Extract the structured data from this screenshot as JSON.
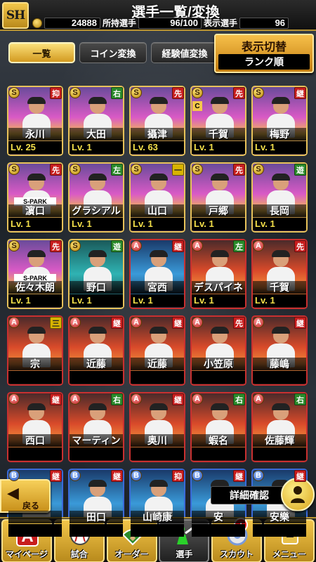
{
  "header": {
    "title": "選手一覧/変換",
    "logo_text": "SH",
    "coins": "24888",
    "owned_label": "所持選手",
    "owned_value": "96/100",
    "display_label": "表示選手",
    "display_value": "96"
  },
  "tabs": [
    {
      "label": "一覧",
      "active": true
    },
    {
      "label": "コイン変換",
      "active": false
    },
    {
      "label": "経験値変換",
      "active": false
    }
  ],
  "toggle": {
    "title": "表示切替",
    "value": "ランク順"
  },
  "players": [
    {
      "rank": "S",
      "pos": "抑",
      "pos_color": "red",
      "name": "永川",
      "lv_label": "Lv.",
      "lv": "25",
      "bg": "gold"
    },
    {
      "rank": "S",
      "pos": "右",
      "pos_color": "green",
      "name": "大田",
      "lv_label": "Lv.",
      "lv": "1",
      "bg": "gold"
    },
    {
      "rank": "S",
      "pos": "先",
      "pos_color": "red",
      "name": "攝津",
      "lv_label": "Lv.",
      "lv": "63",
      "bg": "gold"
    },
    {
      "rank": "S",
      "pos": "先",
      "pos_color": "red",
      "name": "千賀",
      "lv_label": "Lv.",
      "lv": "1",
      "bg": "gold",
      "badge": "C"
    },
    {
      "rank": "S",
      "pos": "継",
      "pos_color": "red",
      "name": "梅野",
      "lv_label": "Lv.",
      "lv": "1",
      "bg": "gold"
    },
    {
      "rank": "S",
      "pos": "先",
      "pos_color": "red",
      "name": "濵口",
      "lv_label": "Lv.",
      "lv": "1",
      "bg": "gold",
      "spark": "S-PARK"
    },
    {
      "rank": "S",
      "pos": "左",
      "pos_color": "green",
      "name": "グラシアル",
      "lv_label": "Lv.",
      "lv": "1",
      "bg": "gold"
    },
    {
      "rank": "S",
      "pos": "一",
      "pos_color": "yellow",
      "name": "山口",
      "lv_label": "Lv.",
      "lv": "1",
      "bg": "gold"
    },
    {
      "rank": "S",
      "pos": "先",
      "pos_color": "red",
      "name": "戸郷",
      "lv_label": "Lv.",
      "lv": "1",
      "bg": "gold"
    },
    {
      "rank": "S",
      "pos": "遊",
      "pos_color": "green",
      "name": "長岡",
      "lv_label": "Lv.",
      "lv": "1",
      "bg": "gold"
    },
    {
      "rank": "S",
      "pos": "先",
      "pos_color": "red",
      "name": "佐々木朗",
      "lv_label": "Lv.",
      "lv": "1",
      "bg": "gold",
      "spark": "S-PARK"
    },
    {
      "rank": "S",
      "pos": "遊",
      "pos_color": "green",
      "name": "野口",
      "lv_label": "Lv.",
      "lv": "1",
      "bg": "teal"
    },
    {
      "rank": "A",
      "pos": "継",
      "pos_color": "red",
      "name": "宮西",
      "lv_label": "Lv.",
      "lv": "1",
      "bg": "blue"
    },
    {
      "rank": "A",
      "pos": "左",
      "pos_color": "green",
      "name": "デスパイネ",
      "lv_label": "Lv.",
      "lv": "1",
      "bg": "orange"
    },
    {
      "rank": "A",
      "pos": "先",
      "pos_color": "red",
      "name": "千賀",
      "lv_label": "Lv.",
      "lv": "1",
      "bg": "orange"
    },
    {
      "rank": "A",
      "pos": "三",
      "pos_color": "yellow",
      "name": "宗",
      "lv_label": "",
      "lv": "",
      "bg": "orange"
    },
    {
      "rank": "A",
      "pos": "継",
      "pos_color": "red",
      "name": "近藤",
      "lv_label": "",
      "lv": "",
      "bg": "orange"
    },
    {
      "rank": "A",
      "pos": "継",
      "pos_color": "red",
      "name": "近藤",
      "lv_label": "",
      "lv": "",
      "bg": "orange"
    },
    {
      "rank": "A",
      "pos": "先",
      "pos_color": "red",
      "name": "小笠原",
      "lv_label": "",
      "lv": "",
      "bg": "orange"
    },
    {
      "rank": "A",
      "pos": "継",
      "pos_color": "red",
      "name": "藤嶋",
      "lv_label": "",
      "lv": "",
      "bg": "orange"
    },
    {
      "rank": "A",
      "pos": "継",
      "pos_color": "red",
      "name": "西口",
      "lv_label": "",
      "lv": "",
      "bg": "orange"
    },
    {
      "rank": "A",
      "pos": "右",
      "pos_color": "green",
      "name": "マーティン",
      "lv_label": "",
      "lv": "",
      "bg": "orange"
    },
    {
      "rank": "A",
      "pos": "継",
      "pos_color": "red",
      "name": "奥川",
      "lv_label": "",
      "lv": "",
      "bg": "orange"
    },
    {
      "rank": "A",
      "pos": "右",
      "pos_color": "green",
      "name": "蝦名",
      "lv_label": "",
      "lv": "",
      "bg": "orange"
    },
    {
      "rank": "A",
      "pos": "右",
      "pos_color": "green",
      "name": "佐藤輝",
      "lv_label": "",
      "lv": "",
      "bg": "orange"
    },
    {
      "rank": "B",
      "pos": "継",
      "pos_color": "red",
      "name": "",
      "lv_label": "",
      "lv": "",
      "bg": "blue"
    },
    {
      "rank": "B",
      "pos": "継",
      "pos_color": "red",
      "name": "田口",
      "lv_label": "",
      "lv": "",
      "bg": "blue"
    },
    {
      "rank": "B",
      "pos": "抑",
      "pos_color": "red",
      "name": "山崎康",
      "lv_label": "",
      "lv": "",
      "bg": "blue"
    },
    {
      "rank": "B",
      "pos": "継",
      "pos_color": "red",
      "name": "安",
      "lv_label": "",
      "lv": "",
      "bg": "blue"
    },
    {
      "rank": "B",
      "pos": "継",
      "pos_color": "red",
      "name": "安樂",
      "lv_label": "",
      "lv": "",
      "bg": "blue"
    }
  ],
  "back_label": "戻る",
  "detail_label": "詳細確認",
  "nav": [
    {
      "label": "マイページ",
      "icon": "a-letter-icon",
      "active": false
    },
    {
      "label": "試合",
      "icon": "baseball-icon",
      "active": false
    },
    {
      "label": "オーダー",
      "icon": "field-icon",
      "active": false
    },
    {
      "label": "選手",
      "icon": "batter-icon",
      "active": true
    },
    {
      "label": "スカウト",
      "icon": "scout-icon",
      "active": false,
      "alert": "!"
    },
    {
      "label": "メニュー",
      "icon": "menu-icon",
      "active": false
    }
  ],
  "colors": {
    "gold": "#f3c64a",
    "accent_red": "#c81e1e",
    "header_border": "#b99432"
  }
}
